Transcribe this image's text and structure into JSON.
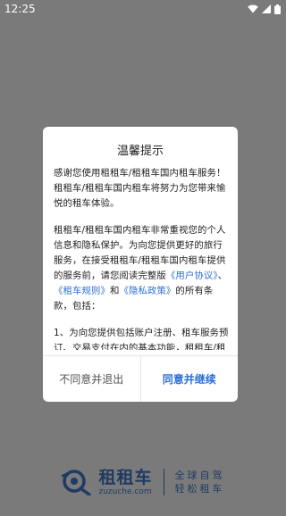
{
  "status_bar": {
    "time": "12:25",
    "icons": [
      "wifi-icon",
      "signal-icon",
      "battery-icon"
    ]
  },
  "dialog": {
    "title": "温馨提示",
    "paragraph1": "感谢您使用租租车/租租车国内租车服务！租租车/租租车国内租车将努力为您带来愉悦的租车体验。",
    "paragraph2_before": "租租车/租租车国内租车非常重视您的个人信息和隐私保护。为向您提供更好的旅行服务，在接受租租车/租租车国内租车提供的服务前，请您阅读完整版",
    "link_user_agreement": "《用户协议》",
    "sep1": "、",
    "link_rental_rules": "《租车规则》",
    "sep2": "和",
    "link_privacy_policy": "《隐私政策》",
    "paragraph2_after": "的所有条款，包括：",
    "paragraph3": "1、为向您提供包括账户注册、租车服务预订、交易支付在内的基本功能，租租车/租租车国内租车可能会基于具体业务场景收集",
    "decline_label": "不同意并退出",
    "accept_label": "同意并继续"
  },
  "brand": {
    "name": "租租车",
    "url": "zuzuche.com",
    "slogan_line1": "全球自驾",
    "slogan_line2": "轻松租车"
  },
  "colors": {
    "overlay": "#7a7a7a",
    "link": "#2d6fd6",
    "brand": "#1f3a63"
  }
}
